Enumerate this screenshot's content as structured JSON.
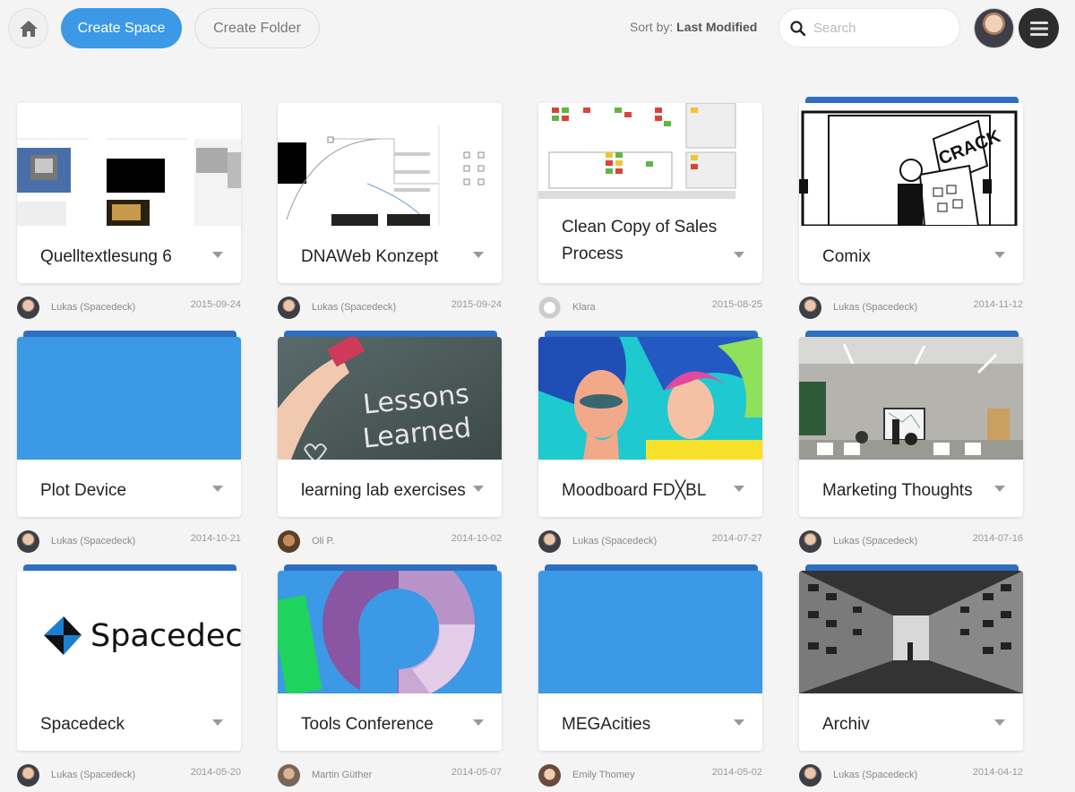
{
  "toolbar": {
    "create_space_label": "Create Space",
    "create_folder_label": "Create Folder",
    "sort_label": "Sort by:",
    "sort_value": "Last Modified",
    "search_placeholder": "Search"
  },
  "spaces": [
    {
      "title": "Quelltextlesung 6",
      "author": "Lukas (Spacedeck)",
      "date": "2015-09-24",
      "thumb": "doc-screens"
    },
    {
      "title": "DNAWeb Konzept",
      "author": "Lukas (Spacedeck)",
      "date": "2015-09-24",
      "thumb": "diagram"
    },
    {
      "title": "Clean Copy of Sales Process",
      "author": "Klara",
      "date": "2015-08-25",
      "thumb": "sticky-notes"
    },
    {
      "title": "Comix",
      "author": "Lukas (Spacedeck)",
      "date": "2014-11-12",
      "thumb": "comic"
    },
    {
      "title": "Plot Device",
      "author": "Lukas (Spacedeck)",
      "date": "2014-10-21",
      "thumb": "blue"
    },
    {
      "title": "learning lab exercises",
      "author": "Oli P.",
      "date": "2014-10-02",
      "thumb": "chalkboard"
    },
    {
      "title": "Moodboard FD╳BL",
      "author": "Lukas (Spacedeck)",
      "date": "2014-07-27",
      "thumb": "colorful-portrait"
    },
    {
      "title": "Marketing Thoughts",
      "author": "Lukas (Spacedeck)",
      "date": "2014-07-16",
      "thumb": "classroom"
    },
    {
      "title": "Spacedeck",
      "author": "Lukas (Spacedeck)",
      "date": "2014-05-20",
      "thumb": "spacedeck-logo"
    },
    {
      "title": "Tools Conference",
      "author": "Martin Güther",
      "date": "2014-05-07",
      "thumb": "logo-ring"
    },
    {
      "title": "MEGAcities",
      "author": "Emily Thomey",
      "date": "2014-05-02",
      "thumb": "blue"
    },
    {
      "title": "Archiv",
      "author": "Lukas (Spacedeck)",
      "date": "2014-04-12",
      "thumb": "archive"
    }
  ],
  "logo_text": "Spacedeck",
  "chalkboard_line1": "Lessons",
  "chalkboard_line2": "Learned",
  "comic_text": "CRACK",
  "colors": {
    "accent": "#3b99e6",
    "folder_tab": "#2f6fc2"
  }
}
